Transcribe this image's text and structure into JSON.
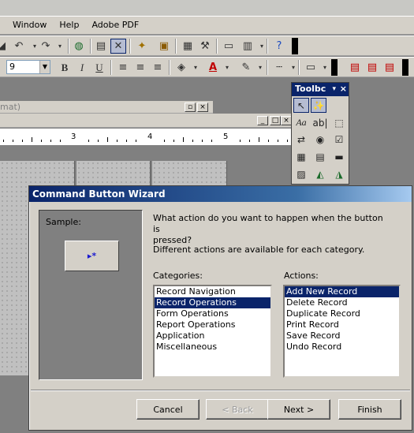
{
  "menu": [
    "Window",
    "Help",
    "Adobe PDF"
  ],
  "toolbar2": {
    "font_size": "9"
  },
  "bg_window": {
    "title_fragment": "mat)"
  },
  "ruler": {
    "numbers": [
      "3",
      "4",
      "5"
    ]
  },
  "toolbox": {
    "title": "Toolbc",
    "close": "×",
    "caret": "▾"
  },
  "wizard": {
    "title": "Command Button Wizard",
    "sample_label": "Sample:",
    "sample_icon": "▸*",
    "question_line1": "What action do you want to happen when the button is",
    "question_line2": "pressed?",
    "hint": "Different actions are available for each category.",
    "categories_label": "Categories:",
    "actions_label": "Actions:",
    "categories": [
      "Record Navigation",
      "Record Operations",
      "Form Operations",
      "Report Operations",
      "Application",
      "Miscellaneous"
    ],
    "actions": [
      "Add New Record",
      "Delete Record",
      "Duplicate Record",
      "Print Record",
      "Save Record",
      "Undo Record"
    ],
    "buttons": {
      "cancel": "Cancel",
      "back": "< Back",
      "next": "Next >",
      "finish": "Finish"
    }
  },
  "colors": {
    "selection": "#0a246a",
    "dialog_face": "#d4d0c8",
    "desktop": "#808080"
  }
}
